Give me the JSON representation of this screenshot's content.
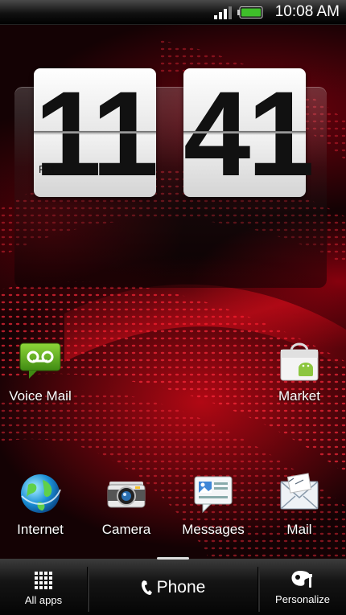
{
  "status_bar": {
    "time": "10:08 AM",
    "signal_icon": "signal-bars-icon",
    "battery_icon": "battery-icon",
    "battery_color": "#3fbf2a"
  },
  "clock_widget": {
    "hours": "11",
    "minutes": "41",
    "ampm": "PM"
  },
  "apps": [
    {
      "label": "Voice Mail",
      "icon": "voicemail-icon"
    },
    {
      "label": "Market",
      "icon": "market-bag-icon"
    },
    {
      "label": "Internet",
      "icon": "globe-icon"
    },
    {
      "label": "Camera",
      "icon": "camera-icon"
    },
    {
      "label": "Messages",
      "icon": "messages-icon"
    },
    {
      "label": "Mail",
      "icon": "mail-envelope-icon"
    }
  ],
  "dock": {
    "all_apps_label": "All apps",
    "phone_label": "Phone",
    "personalize_label": "Personalize"
  },
  "colors": {
    "wallpaper_accent": "#e0101e",
    "voicemail_green": "#5aa51e"
  }
}
